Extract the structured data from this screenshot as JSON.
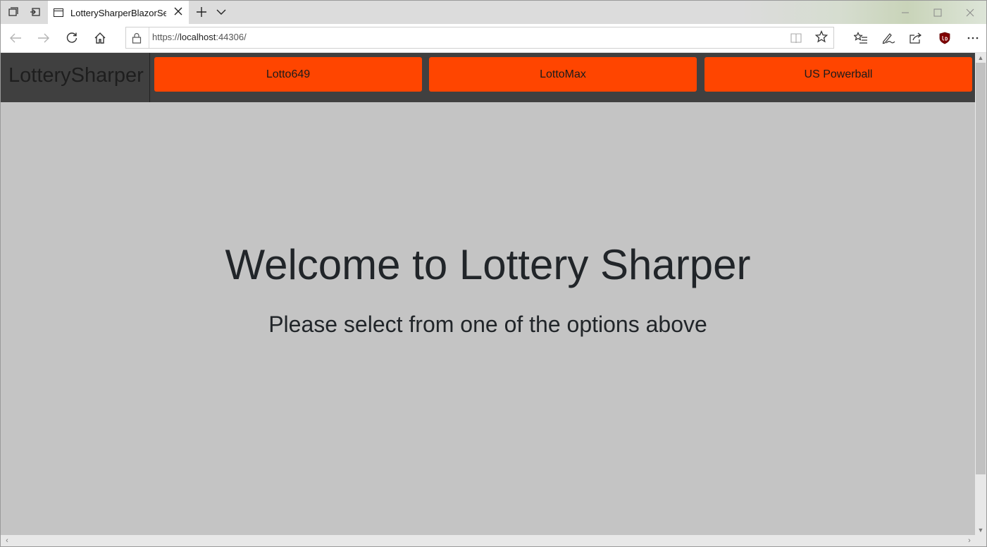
{
  "browser": {
    "tab_title": "LotterySharperBlazorServ",
    "url_scheme": "https://",
    "url_host": "localhost",
    "url_rest": ":44306/",
    "icons": [
      "tab-actions-icon",
      "set-aside-tabs-icon",
      "page-icon",
      "close-icon",
      "plus-icon",
      "chevron-down-icon",
      "minimize-icon",
      "maximize-icon",
      "window-close-icon",
      "back-icon",
      "forward-icon",
      "refresh-icon",
      "home-icon",
      "lock-icon",
      "reading-view-icon",
      "star-icon",
      "favorites-icon",
      "pen-icon",
      "share-icon",
      "ublock-icon",
      "more-icon"
    ]
  },
  "app": {
    "brand": "LotterySharper",
    "nav": [
      {
        "label": "Lotto649"
      },
      {
        "label": "LottoMax"
      },
      {
        "label": "US Powerball"
      }
    ]
  },
  "hero": {
    "title": "Welcome to Lottery Sharper",
    "subtitle": "Please select from one of the options above"
  },
  "colors": {
    "header_bg": "#404040",
    "nav_button_bg": "#ff4500",
    "page_bg": "#c4c4c4",
    "text": "#212529"
  }
}
